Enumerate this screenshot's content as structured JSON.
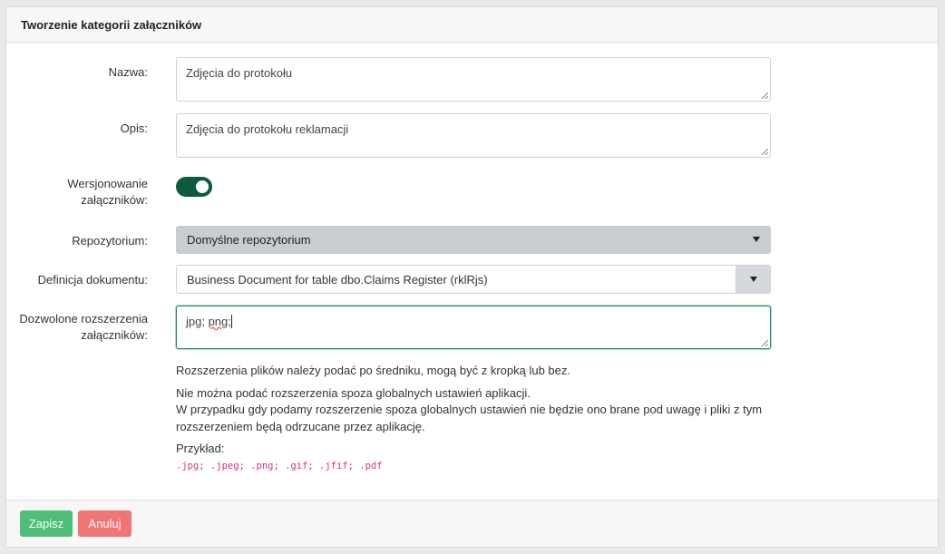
{
  "header": {
    "title": "Tworzenie kategorii załączników"
  },
  "form": {
    "name": {
      "label": "Nazwa:",
      "value": "Zdjęcia do protokołu"
    },
    "description": {
      "label": "Opis:",
      "value": "Zdjęcia do protokołu reklamacji"
    },
    "versioning": {
      "label_line1": "Wersjonowanie",
      "label_line2": "załączników:",
      "enabled": true
    },
    "repository": {
      "label": "Repozytorium:",
      "selected": "Domyślne repozytorium"
    },
    "document_definition": {
      "label": "Definicja dokumentu:",
      "selected": "Business Document for table dbo.Claims Register (rklRjs)"
    },
    "extensions": {
      "label_line1": "Dozwolone rozszerzenia",
      "label_line2": "załączników:",
      "value_part1": "jpg; ",
      "value_part2": "png;"
    }
  },
  "help": {
    "line1": "Rozszerzenia plików należy podać po średniku, mogą być z kropką lub bez.",
    "line2": "Nie można podać rozszerzenia spoza globalnych ustawień aplikacji.",
    "line3": "W przypadku gdy podamy rozszerzenie spoza globalnych ustawień nie będzie ono brane pod uwagę i pliki z tym",
    "line4": "rozszerzeniem będą odrzucane przez aplikację.",
    "example_label": "Przykład:",
    "example_code": ".jpg; .jpeg; .png; .gif; .jfif; .pdf"
  },
  "footer": {
    "save_label": "Zapisz",
    "cancel_label": "Anuluj"
  },
  "colors": {
    "toggle_on": "#0e5a3d",
    "save": "#4dbf79",
    "cancel": "#f07575",
    "focus_border": "#1f8f5b",
    "code": "#d63384"
  }
}
